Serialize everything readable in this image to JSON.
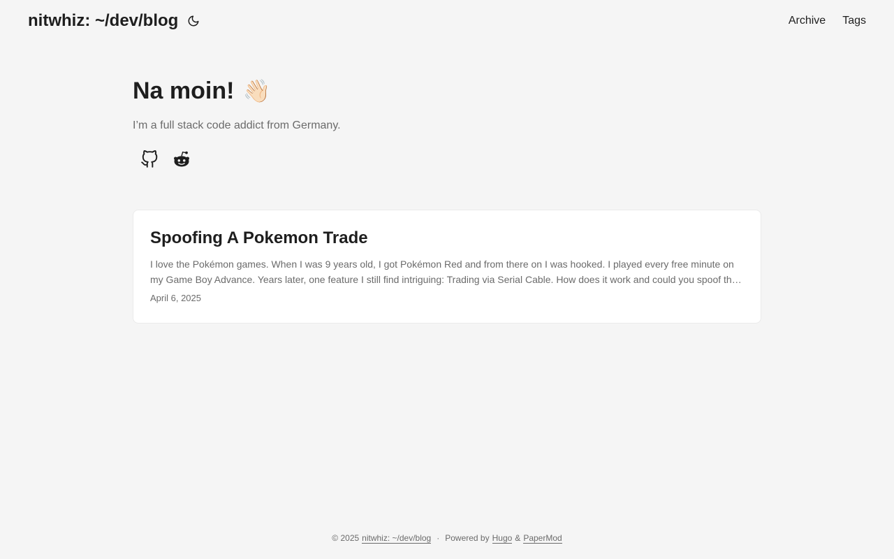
{
  "header": {
    "logo": "nitwhiz: ~/dev/blog",
    "nav": [
      {
        "label": "Archive"
      },
      {
        "label": "Tags"
      }
    ]
  },
  "home": {
    "title": "Na moin!",
    "emoji": "👋🏻",
    "subtitle": "I’m a full stack code addict from Germany.",
    "social_icons": [
      "github-icon",
      "reddit-icon"
    ]
  },
  "posts": [
    {
      "title": "Spoofing A Pokemon Trade",
      "excerpt": "I love the Pokémon games. When I was 9 years old, I got Pokémon Red and from there on I was hooked. I played every free minute on my Game Boy Advance. Years later, one feature I still find intriguing: Trading via Serial Cable. How does it work and could you spoof the trade?",
      "date": "April 6, 2025"
    }
  ],
  "footer": {
    "copyright": "© 2025",
    "site_link": "nitwhiz: ~/dev/blog",
    "separator": "·",
    "powered_by": "Powered by",
    "hugo": "Hugo",
    "amp": "&",
    "papermod": "PaperMod"
  }
}
